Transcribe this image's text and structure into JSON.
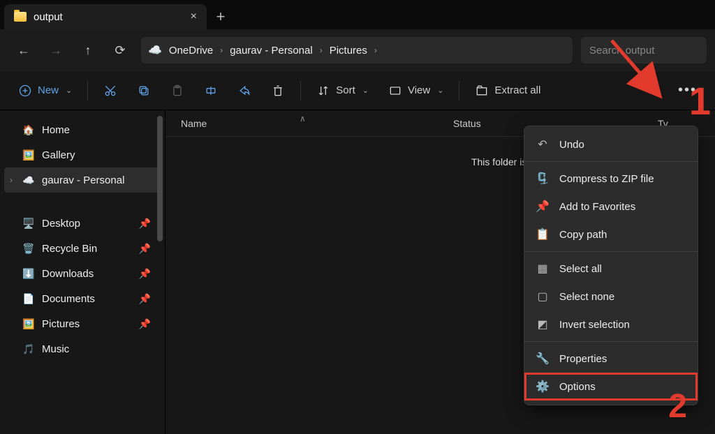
{
  "tab": {
    "title": "output",
    "close": "×",
    "new": "+"
  },
  "nav": {
    "breadcrumbs": [
      "OneDrive",
      "gaurav - Personal",
      "Pictures"
    ],
    "search_placeholder": "Search output"
  },
  "toolbar": {
    "new": "New",
    "sort": "Sort",
    "view": "View",
    "extract": "Extract all"
  },
  "sidebar": {
    "home": "Home",
    "gallery": "Gallery",
    "personal": "gaurav - Personal",
    "desktop": "Desktop",
    "recycle": "Recycle Bin",
    "downloads": "Downloads",
    "documents": "Documents",
    "pictures": "Pictures",
    "music": "Music"
  },
  "columns": {
    "name": "Name",
    "status": "Status",
    "type": "Ty"
  },
  "empty_text": "This folder is e",
  "menu": {
    "undo": "Undo",
    "compress": "Compress to ZIP file",
    "favorites": "Add to Favorites",
    "copypath": "Copy path",
    "selectall": "Select all",
    "selectnone": "Select none",
    "invert": "Invert selection",
    "properties": "Properties",
    "options": "Options"
  },
  "annotations": {
    "one": "1",
    "two": "2"
  }
}
